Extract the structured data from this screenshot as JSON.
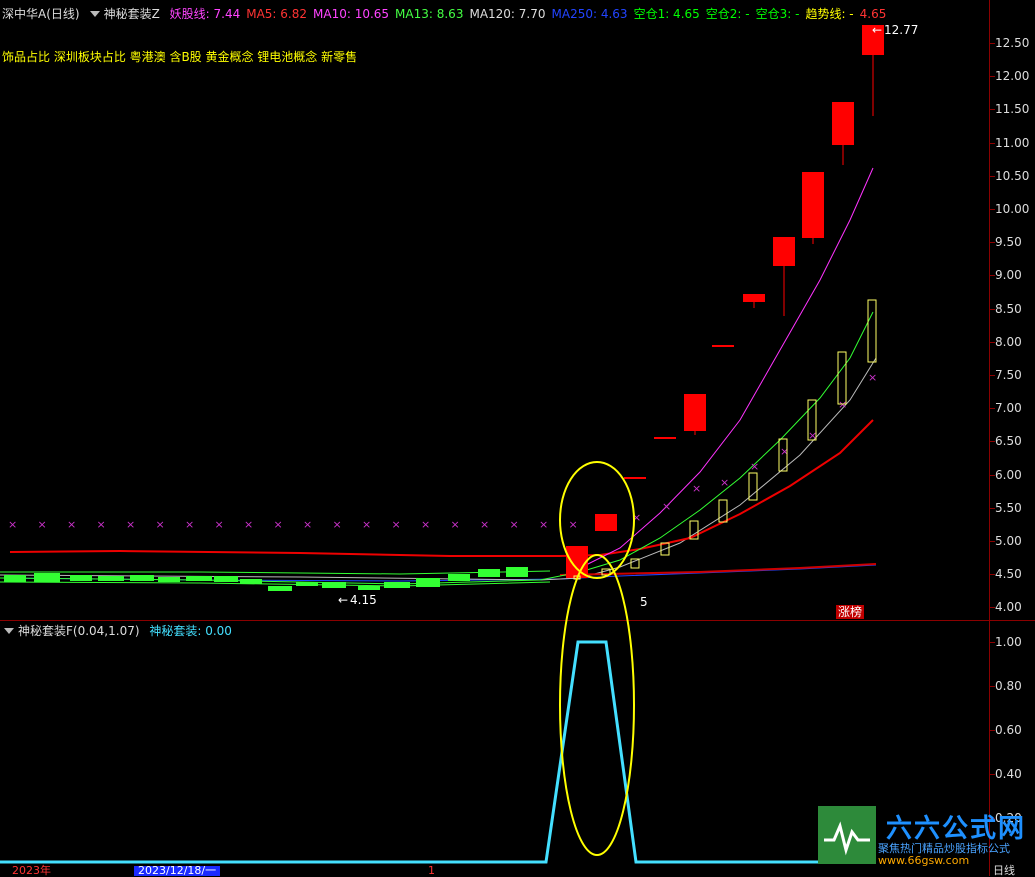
{
  "header": {
    "stock": "深中华A(日线)",
    "indicator": "神秘套装Z",
    "items": [
      {
        "label": "妖股线: 7.44",
        "color": "#ff44ff"
      },
      {
        "label": "MA5: 6.82",
        "color": "#ff3333"
      },
      {
        "label": "MA10: 10.65",
        "color": "#ff44ff"
      },
      {
        "label": "MA13: 8.63",
        "color": "#44ff44"
      },
      {
        "label": "MA120: 7.70",
        "color": "#dddddd"
      },
      {
        "label": "MA250: 4.63",
        "color": "#2244ff"
      },
      {
        "label": "空仓1: 4.65",
        "color": "#00ff00"
      },
      {
        "label": "空仓2: -",
        "color": "#00ff00"
      },
      {
        "label": "空仓3: -",
        "color": "#00ff00"
      },
      {
        "label": "趋势线: -",
        "color": "#ffff00"
      },
      {
        "label": "4.65",
        "color": "#ff3333"
      }
    ]
  },
  "concepts": "饰品占比 深圳板块占比 粤港澳 含B股 黄金概念 锂电池概念 新零售",
  "price_axis": [
    "12.50",
    "12.00",
    "11.50",
    "11.00",
    "10.50",
    "10.00",
    "9.50",
    "9.00",
    "8.50",
    "8.00",
    "7.50",
    "7.00",
    "6.50",
    "6.00",
    "5.50",
    "5.00",
    "4.50",
    "4.00"
  ],
  "annotations": {
    "high": "12.77",
    "low": "4.15",
    "count": "5",
    "zhangbang": "涨榜"
  },
  "sub": {
    "title": "神秘套装F(0.04,1.07)",
    "value": "神秘套装: 0.00",
    "axis": [
      "1.00",
      "0.80",
      "0.60",
      "0.40",
      "0.20"
    ]
  },
  "bottom": {
    "year": "2023年",
    "date": "2023/12/18/一",
    "mark": "1",
    "period": "日线"
  },
  "brand": {
    "title": "六六公式网",
    "subtitle": "聚焦热门精品炒股指标公式",
    "url": "www.66gsw.com"
  },
  "colors": {
    "up": "#ff0000",
    "down": "#00ff00",
    "highlight": "#ffff00",
    "signal": "#44e0ff"
  }
}
